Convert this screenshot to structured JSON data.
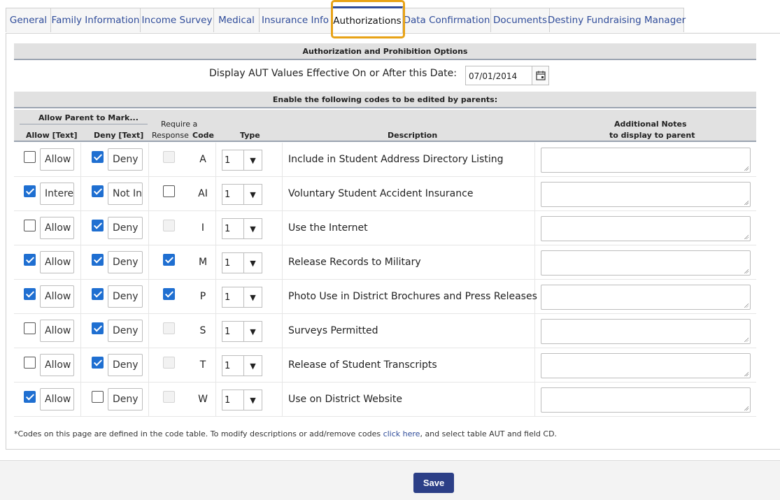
{
  "tabs": [
    {
      "label": "General"
    },
    {
      "label": "Family Information"
    },
    {
      "label": "Income Survey"
    },
    {
      "label": "Medical"
    },
    {
      "label": "Insurance Info"
    },
    {
      "label": "Authorizations"
    },
    {
      "label": "Data Confirmation"
    },
    {
      "label": "Documents"
    },
    {
      "label": "Destiny Fundraising Manager"
    }
  ],
  "section_title": "Authorization and Prohibition Options",
  "date_filter": {
    "label": "Display AUT Values Effective On or After this Date:",
    "value": "07/01/2014",
    "calendar_icon": "calendar-icon"
  },
  "codes_header": "Enable the following codes to be edited by parents:",
  "columns": {
    "group": "Allow Parent to Mark...",
    "allow": "Allow [Text]",
    "deny": "Deny [Text]",
    "require_line1": "Require a",
    "require_line2": "Response",
    "code": "Code",
    "type": "Type",
    "description": "Description",
    "notes_line1": "Additional Notes",
    "notes_line2": "to display to parent"
  },
  "rows": [
    {
      "allow_checked": false,
      "allow_text": "Allow",
      "deny_checked": true,
      "deny_text": "Deny",
      "require": "disabled",
      "code": "A",
      "type": "1",
      "description": "Include in Student Address Directory Listing",
      "notes": ""
    },
    {
      "allow_checked": true,
      "allow_text": "Interested",
      "deny_checked": true,
      "deny_text": "Not Interested",
      "require": "unchecked",
      "code": "AI",
      "type": "1",
      "description": "Voluntary Student Accident Insurance",
      "notes": ""
    },
    {
      "allow_checked": false,
      "allow_text": "Allow",
      "deny_checked": true,
      "deny_text": "Deny",
      "require": "disabled",
      "code": "I",
      "type": "1",
      "description": "Use the Internet",
      "notes": ""
    },
    {
      "allow_checked": true,
      "allow_text": "Allow",
      "deny_checked": true,
      "deny_text": "Deny",
      "require": "checked",
      "code": "M",
      "type": "1",
      "description": "Release Records to Military",
      "notes": ""
    },
    {
      "allow_checked": true,
      "allow_text": "Allow",
      "deny_checked": true,
      "deny_text": "Deny",
      "require": "checked",
      "code": "P",
      "type": "1",
      "description": "Photo Use in District Brochures and Press Releases",
      "notes": ""
    },
    {
      "allow_checked": false,
      "allow_text": "Allow",
      "deny_checked": true,
      "deny_text": "Deny",
      "require": "disabled",
      "code": "S",
      "type": "1",
      "description": "Surveys Permitted",
      "notes": ""
    },
    {
      "allow_checked": false,
      "allow_text": "Allow",
      "deny_checked": true,
      "deny_text": "Deny",
      "require": "disabled",
      "code": "T",
      "type": "1",
      "description": "Release of Student Transcripts",
      "notes": ""
    },
    {
      "allow_checked": true,
      "allow_text": "Allow",
      "deny_checked": false,
      "deny_text": "Deny",
      "require": "disabled",
      "code": "W",
      "type": "1",
      "description": "Use on District Website",
      "notes": ""
    }
  ],
  "footnote": {
    "before": "*Codes on this page are defined in the code table. To modify descriptions or add/remove codes ",
    "link": "click here",
    "after": ", and select table AUT and field CD."
  },
  "save_label": "Save",
  "colors": {
    "accent": "#2f4c9a",
    "focus": "#e8a317",
    "checkbox": "#1f6fd1",
    "save": "#2c3f87"
  }
}
